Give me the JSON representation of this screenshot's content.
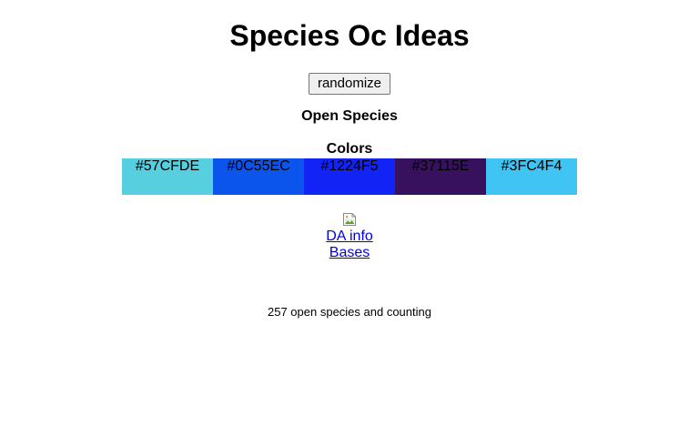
{
  "page": {
    "title": "Species Oc Ideas"
  },
  "controls": {
    "randomize_label": "randomize"
  },
  "species": {
    "heading": "Open Species"
  },
  "colors": {
    "heading": "Colors",
    "swatches": [
      {
        "hex": "#57CFDE",
        "label": "#57CFDE"
      },
      {
        "hex": "#0C55EC",
        "label": "#0C55EC"
      },
      {
        "hex": "#1224F5",
        "label": "#1224F5"
      },
      {
        "hex": "#37115E",
        "label": "#37115E"
      },
      {
        "hex": "#3FC4F4",
        "label": "#3FC4F4"
      }
    ]
  },
  "image": {
    "icon": "broken-image-icon"
  },
  "links": {
    "da_info": "DA info",
    "bases": "Bases"
  },
  "footer": {
    "count_text": "257 open species and counting"
  }
}
